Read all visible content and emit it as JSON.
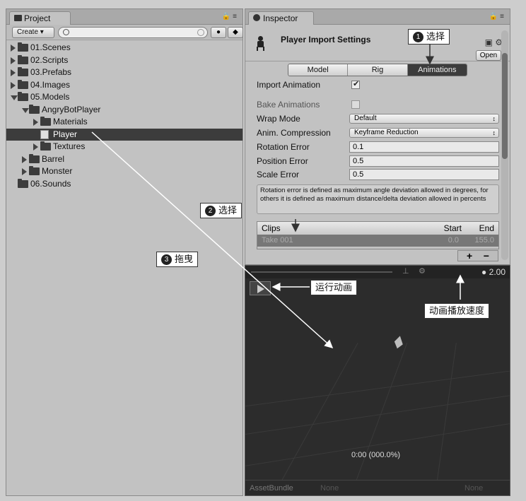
{
  "project": {
    "tab_label": "Project",
    "create_label": "Create",
    "search_placeholder": "",
    "tree": [
      {
        "label": "01.Scenes",
        "depth": 0,
        "arrow": "right"
      },
      {
        "label": "02.Scripts",
        "depth": 0,
        "arrow": "right"
      },
      {
        "label": "03.Prefabs",
        "depth": 0,
        "arrow": "right"
      },
      {
        "label": "04.Images",
        "depth": 0,
        "arrow": "right"
      },
      {
        "label": "05.Models",
        "depth": 0,
        "arrow": "down"
      },
      {
        "label": "AngryBotPlayer",
        "depth": 1,
        "arrow": "down"
      },
      {
        "label": "Materials",
        "depth": 2,
        "arrow": "right"
      },
      {
        "label": "Player",
        "depth": 2,
        "arrow": "none",
        "selected": true
      },
      {
        "label": "Textures",
        "depth": 2,
        "arrow": "right"
      },
      {
        "label": "Barrel",
        "depth": 1,
        "arrow": "right"
      },
      {
        "label": "Monster",
        "depth": 1,
        "arrow": "right"
      },
      {
        "label": "06.Sounds",
        "depth": 0,
        "arrow": "none"
      }
    ]
  },
  "inspector": {
    "tab_label": "Inspector",
    "title": "Player Import Settings",
    "open_label": "Open",
    "tabs": [
      "Model",
      "Rig",
      "Animations"
    ],
    "active_tab": "Animations",
    "import_animation_label": "Import Animation",
    "bake_animations_label": "Bake Animations",
    "wrap_mode_label": "Wrap Mode",
    "wrap_mode_value": "Default",
    "anim_compression_label": "Anim. Compression",
    "anim_compression_value": "Keyframe Reduction",
    "rotation_error_label": "Rotation Error",
    "rotation_error_value": "0.1",
    "position_error_label": "Position Error",
    "position_error_value": "0.5",
    "scale_error_label": "Scale Error",
    "scale_error_value": "0.5",
    "help_text": "Rotation error is defined as maximum angle deviation allowed in degrees, for others it is defined as maximum distance/delta deviation allowed in percents",
    "clips_header": "Clips",
    "start_header": "Start",
    "end_header": "End",
    "clip_name": "Take 001",
    "clip_start": "0.0",
    "clip_end": "155.0",
    "plus_label": "+",
    "minus_label": "−"
  },
  "preview": {
    "speed_label": "2.00",
    "timecode": "0:00 (000.0%)",
    "asset_bundle_label": "AssetBundle",
    "asset_bundle_value": "None",
    "asset_bundle_variant": "None"
  },
  "annotations": {
    "step1_num": "1",
    "step1_text": "选择",
    "step2_num": "2",
    "step2_text": "选择",
    "step3_num": "3",
    "step3_text": "拖曳",
    "play_note": "运行动画",
    "speed_note": "动画播放速度"
  },
  "colors": {
    "selection_dark": "#3c3c3c",
    "preview_bg": "#2c2c2c",
    "panel_bg": "#c2c2c2"
  }
}
